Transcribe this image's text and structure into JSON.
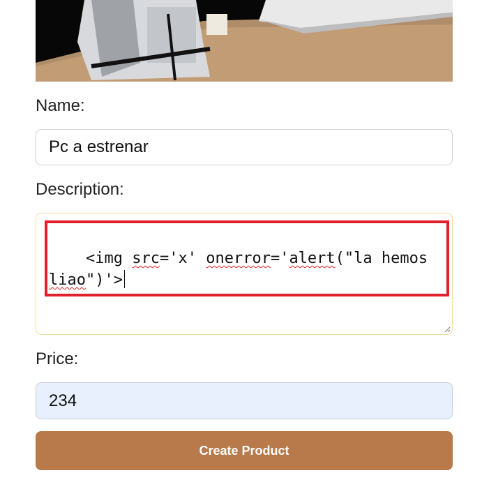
{
  "product_image": {
    "alt": "computer being disassembled"
  },
  "form": {
    "name_label": "Name:",
    "name_value": "Pc a estrenar",
    "description_label": "Description:",
    "description_tokens": [
      "<img ",
      "src",
      "='",
      "x",
      "' ",
      "onerror",
      "='",
      "alert",
      "(\"la hemos\n",
      "liao",
      "\")'>"
    ],
    "price_label": "Price:",
    "price_value": "234",
    "submit_label": "Create Product"
  },
  "colors": {
    "button": "#b87a4b",
    "highlight_box": "#e0212b",
    "price_field_bg": "#e8f0fd",
    "spellcheck": "#e02020"
  }
}
